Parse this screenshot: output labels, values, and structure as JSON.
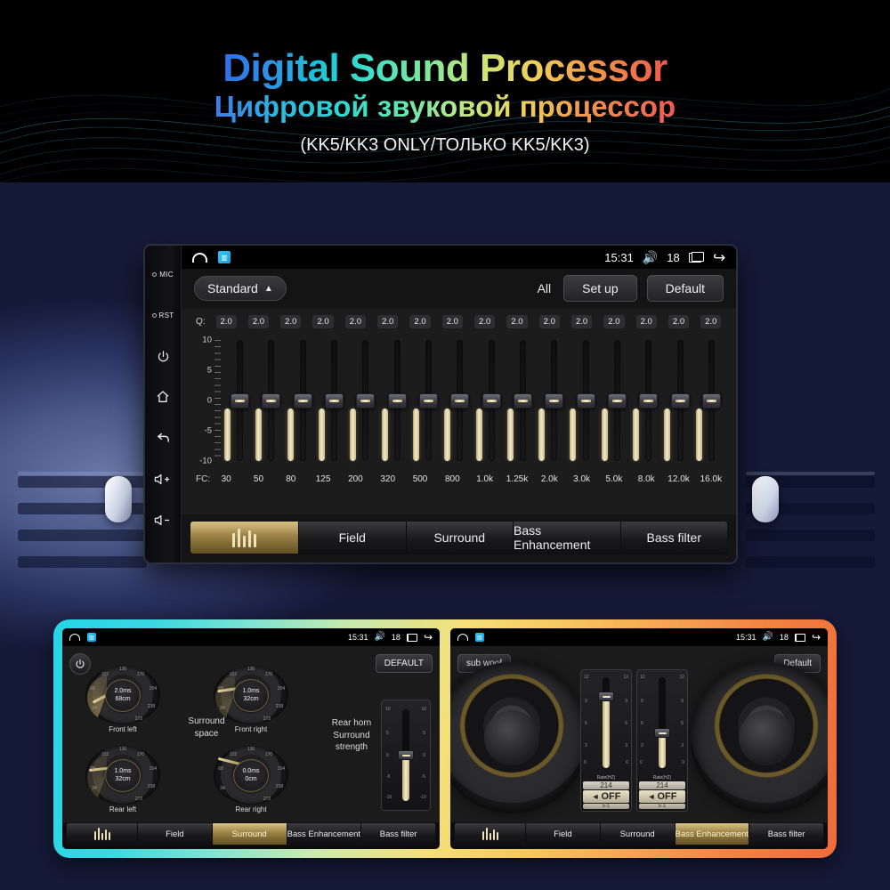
{
  "hero": {
    "title_en": "Digital Sound Processor",
    "title_ru": "Цифровой звуковой процессор",
    "subtitle": "(KK5/KK3 ONLY/ТОЛЬКО KK5/KK3)"
  },
  "bezel": {
    "mic_label": "MIC",
    "rst_label": "RST",
    "power_icon": "⏻",
    "home_icon": "⌂",
    "back_icon": "↺",
    "vol_up": "+",
    "vol_down": "−"
  },
  "status_bar": {
    "time": "15:31",
    "volume": "18",
    "home_icon": "home-icon",
    "app_icon": "app-icon",
    "speaker_icon": "🔊",
    "recents_icon": "recents-icon",
    "back_icon": "↪"
  },
  "eq_header": {
    "preset": "Standard",
    "caret": "⌃",
    "all_label": "All",
    "setup_label": "Set up",
    "default_label": "Default"
  },
  "equalizer": {
    "q_label": "Q:",
    "fc_label": "FC:",
    "axis_labels": [
      "10",
      "5",
      "0",
      "-5",
      "-10"
    ],
    "bands": [
      {
        "freq": "30",
        "q": "2.0",
        "gain": 0
      },
      {
        "freq": "50",
        "q": "2.0",
        "gain": 0
      },
      {
        "freq": "80",
        "q": "2.0",
        "gain": 0
      },
      {
        "freq": "125",
        "q": "2.0",
        "gain": 0
      },
      {
        "freq": "200",
        "q": "2.0",
        "gain": 0
      },
      {
        "freq": "320",
        "q": "2.0",
        "gain": 0
      },
      {
        "freq": "500",
        "q": "2.0",
        "gain": 0
      },
      {
        "freq": "800",
        "q": "2.0",
        "gain": 0
      },
      {
        "freq": "1.0k",
        "q": "2.0",
        "gain": 0
      },
      {
        "freq": "1.25k",
        "q": "2.0",
        "gain": 0
      },
      {
        "freq": "2.0k",
        "q": "2.0",
        "gain": 0
      },
      {
        "freq": "3.0k",
        "q": "2.0",
        "gain": 0
      },
      {
        "freq": "5.0k",
        "q": "2.0",
        "gain": 0
      },
      {
        "freq": "8.0k",
        "q": "2.0",
        "gain": 0
      },
      {
        "freq": "12.0k",
        "q": "2.0",
        "gain": 0
      },
      {
        "freq": "16.0k",
        "q": "2.0",
        "gain": 0
      }
    ]
  },
  "tabs": {
    "eq_icon": "equalizer-icon",
    "field": "Field",
    "surround": "Surround",
    "bass_enhancement": "Bass Enhancement",
    "bass_filter": "Bass filter",
    "active_main": "equalizer",
    "active_left": "Surround",
    "active_right": "Bass Enhancement"
  },
  "surround_screen": {
    "power_icon": "⏻",
    "default_label": "DEFAULT",
    "center_label_line1": "Surround",
    "center_label_line2": "space",
    "rear_label_line1": "Rear horn",
    "rear_label_line2": "Surround",
    "rear_label_line3": "strength",
    "knob_scale": [
      "136",
      "170",
      "204",
      "238",
      "272",
      "102",
      "68",
      "34"
    ],
    "knobs": [
      {
        "name": "Front left",
        "delay": "2.0ms",
        "distance": "68cm"
      },
      {
        "name": "Front right",
        "delay": "1.0ms",
        "distance": "32cm"
      },
      {
        "name": "Rear left",
        "delay": "1.0ms",
        "distance": "32cm"
      },
      {
        "name": "Rear right",
        "delay": "0.0ms",
        "distance": "0cm"
      }
    ],
    "slider_scale": [
      "10",
      "5",
      "0",
      "-5",
      "-10"
    ]
  },
  "bass_screen": {
    "subwoof_label": "sub woof",
    "default_label": "Default",
    "slider_scale": [
      "12",
      "9",
      "6",
      "3",
      "0"
    ],
    "channels": [
      {
        "rate_label": "Rate(HZ)",
        "rate_value": "214",
        "state": "OFF",
        "sub_value": "5-1"
      },
      {
        "rate_label": "Rate(HZ)",
        "rate_value": "214",
        "state": "OFF",
        "sub_value": "5-1"
      }
    ]
  },
  "colors": {
    "gold": "#d8c384",
    "accent_cyan": "#25d5e8",
    "accent_orange": "#ef6a3c",
    "screen_bg": "#1c1c1d"
  }
}
